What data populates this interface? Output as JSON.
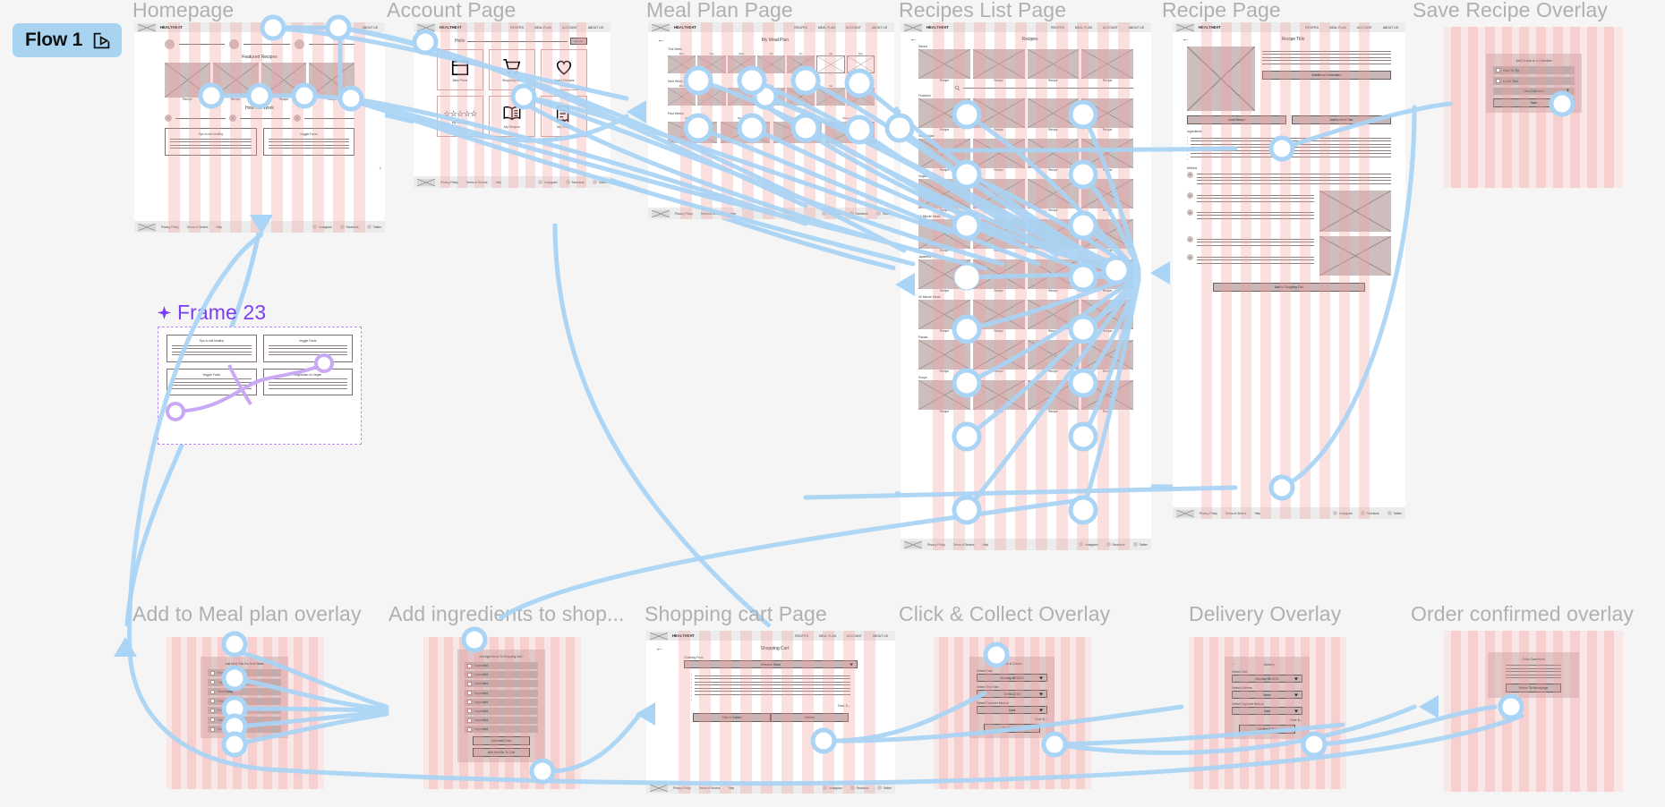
{
  "flow": {
    "badge_label": "Flow 1",
    "present_icon": "present-play-icon"
  },
  "colors": {
    "connector": "#a9d4f5",
    "component_purple": "#7b3ff2",
    "frame_title": "#b0b0b0",
    "badge_bg": "#a8d4f2",
    "grid_red": "#f4a0a0"
  },
  "frames": [
    {
      "id": "homepage",
      "title": "Homepage"
    },
    {
      "id": "account",
      "title": "Account Page"
    },
    {
      "id": "mealplan",
      "title": "Meal Plan Page"
    },
    {
      "id": "recipeslist",
      "title": "Recipes List Page"
    },
    {
      "id": "recipe",
      "title": "Recipe Page"
    },
    {
      "id": "saverecipe",
      "title": "Save Recipe Overlay"
    },
    {
      "id": "frame23",
      "title": "Frame 23",
      "is_component": true
    },
    {
      "id": "addmealplan",
      "title": "Add to Meal plan overlay"
    },
    {
      "id": "addingredients",
      "title": "Add ingredients to shop..."
    },
    {
      "id": "shoppingcart",
      "title": "Shopping cart Page"
    },
    {
      "id": "clickcollect",
      "title": "Click & Collect Overlay"
    },
    {
      "id": "delivery",
      "title": "Delivery Overlay"
    },
    {
      "id": "orderconfirmed",
      "title": "Order confirmed overlay"
    }
  ],
  "common": {
    "brand": "HEALTHEAT",
    "nav": [
      "RECIPES",
      "MEAL PLAN",
      "ACCOUNT",
      "ABOUT US"
    ],
    "footer_links": [
      "Privacy Policy",
      "Terms of Service",
      "Help"
    ],
    "footer_social": [
      "Instagram",
      "Facebook",
      "Twitter"
    ],
    "back_arrow": "←",
    "recipe_caption": "Recipe"
  },
  "homepage": {
    "featured_heading": "Featured Recipes",
    "how_heading": "How We Work",
    "steps": [
      "1",
      "2",
      "3"
    ],
    "cards": [
      "Tips to eat healthy",
      "Veggie Facts"
    ],
    "recipe_captions": [
      "Recipe",
      "Recipe",
      "Recipe",
      "Recipe"
    ]
  },
  "account": {
    "greeting": "Hello",
    "logout_label": "Log out",
    "tiles": [
      {
        "icon": "calendar-icon",
        "label": "Meal Plans"
      },
      {
        "icon": "shopping-cart-icon",
        "label": "Shopping Cart"
      },
      {
        "icon": "heart-icon",
        "label": "Saved Recipes"
      },
      {
        "icon": "stars-icon",
        "label": "My Reviews"
      },
      {
        "icon": "book-icon",
        "label": "My Recipes"
      },
      {
        "icon": "receipt-icon",
        "label": "My Orders"
      }
    ]
  },
  "mealplan": {
    "heading": "My Meal Plan",
    "sections": [
      "This Week",
      "Next Week",
      "Past Weeks"
    ],
    "days": [
      "Mon",
      "Tue",
      "Wed",
      "Thu",
      "Fri",
      "Sat",
      "Sun"
    ],
    "past_labels": [
      "Week of 08/01",
      "Week of 07/25",
      "Week of 07/18",
      "Week of 07/11"
    ]
  },
  "recipeslist": {
    "heading": "Recipes",
    "search_icon": "search-icon",
    "categories": [
      "Saved",
      "Featured",
      "Veg / Salad",
      "Vegan",
      "10 Minute Meals",
      "Japanese",
      "30 Minute Meals",
      "Pastas",
      "Soups"
    ],
    "item_caption": "Recipe"
  },
  "recipe": {
    "title": "Recipe Title",
    "nutrition_button": "Nutritional Information",
    "save_button": "Save Recipe",
    "add_meal_plan_button": "Add to Meal Plan",
    "ingredients_heading": "Ingredients",
    "method_heading": "Method",
    "add_to_cart_button": "Add to Shopping Cart",
    "step_numbers": [
      "1",
      "2",
      "3",
      "4",
      "5"
    ]
  },
  "saverecipe": {
    "heading": "Add Recipe to a Collection",
    "options": [
      "Want To Try",
      "Loved This"
    ],
    "new_collection": "New Collection",
    "new_collection_icon": "plus-icon",
    "save_button": "Save"
  },
  "addmealplan": {
    "heading": "Add Meal Plan For Next Week",
    "days": [
      "Monday",
      "Tuesday",
      "Wednesday",
      "Thursday",
      "Friday",
      "Saturday",
      "Sunday"
    ]
  },
  "addingredients": {
    "heading": "Add Ingredients To Shopping Cart?",
    "items": [
      "Ingredient",
      "Ingredient",
      "Ingredient",
      "Ingredient",
      "Ingredient",
      "Ingredient",
      "Ingredient",
      "Ingredient"
    ],
    "buttons": [
      "Add And Close",
      "Add And Go To Cart"
    ]
  },
  "shoppingcart": {
    "heading": "Shopping Cart",
    "ordering_from_label": "Ordering From",
    "store_select_value": "Selected Store",
    "total_label": "Total: $—",
    "buttons": [
      "Click & Collect",
      "Deliver"
    ]
  },
  "clickcollect": {
    "heading": "Click & Collect",
    "fields": [
      {
        "label": "Select Date",
        "value": "Monday 08/19/22"
      },
      {
        "label": "Select Time Slot",
        "value": "12:00-12:30"
      },
      {
        "label": "Select Payment Method",
        "value": "Card"
      }
    ],
    "total_label": "Total: $—",
    "confirm_button": "Confirm & Pay"
  },
  "delivery": {
    "heading": "Delivery",
    "fields": [
      {
        "label": "Select Date",
        "value": "Monday 08/19/22"
      },
      {
        "label": "Select Address",
        "value": "Home"
      },
      {
        "label": "Select Payment Method",
        "value": "Card"
      }
    ],
    "total_label": "Total: $—",
    "confirm_button": "Confirm & Pay"
  },
  "orderconfirmed": {
    "heading": "Order Confirmed",
    "return_button": "Return To Homepage"
  },
  "frame23": {
    "cards": [
      "Tips to eat healthy",
      "Veggie Facts",
      "Veggie Facts",
      "Vegetarian vs Vegan"
    ]
  }
}
